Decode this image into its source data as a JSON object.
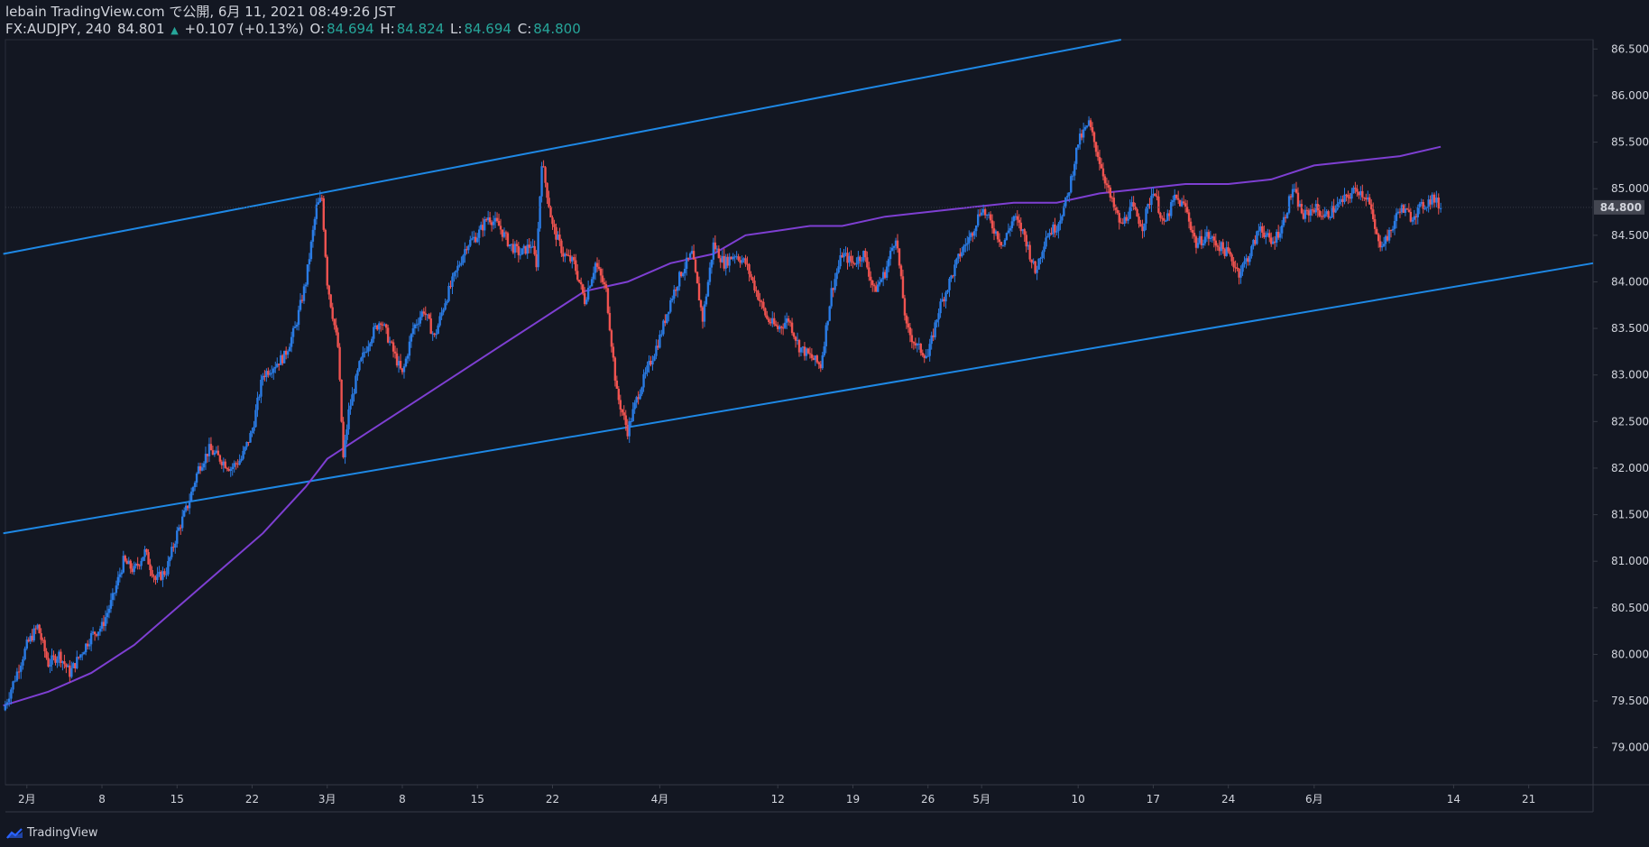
{
  "header": {
    "line1": "lebain TradingView.com で公開, 6月 11, 2021 08:49:26 JST",
    "symbol": "FX:AUDJPY, 240",
    "last": "84.801",
    "change": "+0.107 (+0.13%)",
    "o_label": "O:",
    "o_value": "84.694",
    "h_label": "H:",
    "h_value": "84.824",
    "l_label": "L:",
    "l_value": "84.694",
    "c_label": "C:",
    "c_value": "84.800"
  },
  "brand": {
    "name": "TradingView",
    "icon": "tradingview-logo-icon"
  },
  "colors": {
    "background": "#131722",
    "bullish": "#2a7be4",
    "bearish": "#ef5350",
    "moving_average": "#7e3fd2",
    "channel": "#1e88e5",
    "price_label_bg": "#434651"
  },
  "chart_data": {
    "type": "candlestick",
    "symbol": "FX:AUDJPY",
    "interval": "240",
    "ylim": [
      78.6,
      86.6
    ],
    "y_ticks": [
      "79.000",
      "79.500",
      "80.000",
      "80.500",
      "81.000",
      "81.500",
      "82.000",
      "82.500",
      "83.000",
      "83.500",
      "84.000",
      "84.500",
      "85.000",
      "85.500",
      "86.000",
      "86.500"
    ],
    "x_ticks": [
      {
        "label": "2月",
        "day": 0
      },
      {
        "label": "8",
        "day": 7
      },
      {
        "label": "15",
        "day": 14
      },
      {
        "label": "22",
        "day": 21
      },
      {
        "label": "3月",
        "day": 28
      },
      {
        "label": "8",
        "day": 35
      },
      {
        "label": "15",
        "day": 42
      },
      {
        "label": "22",
        "day": 49
      },
      {
        "label": "4月",
        "day": 59
      },
      {
        "label": "12",
        "day": 70
      },
      {
        "label": "19",
        "day": 77
      },
      {
        "label": "26",
        "day": 84
      },
      {
        "label": "5月",
        "day": 89
      },
      {
        "label": "10",
        "day": 98
      },
      {
        "label": "17",
        "day": 105
      },
      {
        "label": "24",
        "day": 112
      },
      {
        "label": "6月",
        "day": 120
      },
      {
        "label": "14",
        "day": 133
      },
      {
        "label": "21",
        "day": 140
      }
    ],
    "x_range_days": [
      -2,
      146
    ],
    "current_price": "84.800",
    "close_path": [
      [
        -2.2,
        79.4
      ],
      [
        0,
        80.1
      ],
      [
        1,
        80.3
      ],
      [
        2,
        79.9
      ],
      [
        3,
        80.0
      ],
      [
        4,
        79.8
      ],
      [
        5,
        80.0
      ],
      [
        6,
        80.2
      ],
      [
        7,
        80.3
      ],
      [
        8,
        80.6
      ],
      [
        9,
        81.0
      ],
      [
        10,
        80.9
      ],
      [
        11,
        81.1
      ],
      [
        12,
        80.8
      ],
      [
        13,
        80.9
      ],
      [
        14,
        81.3
      ],
      [
        15,
        81.6
      ],
      [
        16,
        82.0
      ],
      [
        17,
        82.2
      ],
      [
        18,
        82.1
      ],
      [
        19,
        82.0
      ],
      [
        20,
        82.1
      ],
      [
        21,
        82.4
      ],
      [
        22,
        83.0
      ],
      [
        23,
        83.1
      ],
      [
        24,
        83.2
      ],
      [
        25,
        83.5
      ],
      [
        26,
        84.0
      ],
      [
        27,
        84.8
      ],
      [
        27.5,
        84.9
      ],
      [
        28,
        84.0
      ],
      [
        29,
        83.3
      ],
      [
        29.5,
        82.1
      ],
      [
        30,
        82.6
      ],
      [
        31,
        83.1
      ],
      [
        32,
        83.4
      ],
      [
        33,
        83.6
      ],
      [
        34,
        83.3
      ],
      [
        35,
        83.0
      ],
      [
        36,
        83.5
      ],
      [
        37,
        83.7
      ],
      [
        38,
        83.4
      ],
      [
        39,
        83.8
      ],
      [
        40,
        84.1
      ],
      [
        41,
        84.4
      ],
      [
        42,
        84.5
      ],
      [
        43,
        84.7
      ],
      [
        44,
        84.6
      ],
      [
        45,
        84.4
      ],
      [
        46,
        84.3
      ],
      [
        47,
        84.4
      ],
      [
        47.5,
        84.2
      ],
      [
        48,
        85.3
      ],
      [
        49,
        84.6
      ],
      [
        50,
        84.3
      ],
      [
        51,
        84.2
      ],
      [
        52,
        83.8
      ],
      [
        53,
        84.2
      ],
      [
        54,
        83.9
      ],
      [
        55,
        82.8
      ],
      [
        56,
        82.4
      ],
      [
        57,
        82.8
      ],
      [
        58,
        83.1
      ],
      [
        59,
        83.4
      ],
      [
        60,
        83.8
      ],
      [
        61,
        84.1
      ],
      [
        62,
        84.3
      ],
      [
        63,
        83.6
      ],
      [
        64,
        84.4
      ],
      [
        65,
        84.2
      ],
      [
        66,
        84.3
      ],
      [
        67,
        84.2
      ],
      [
        68,
        83.9
      ],
      [
        69,
        83.6
      ],
      [
        70,
        83.5
      ],
      [
        71,
        83.6
      ],
      [
        72,
        83.3
      ],
      [
        73,
        83.2
      ],
      [
        74,
        83.1
      ],
      [
        75,
        83.9
      ],
      [
        76,
        84.3
      ],
      [
        77,
        84.2
      ],
      [
        78,
        84.3
      ],
      [
        79,
        83.9
      ],
      [
        80,
        84.1
      ],
      [
        81,
        84.5
      ],
      [
        82,
        83.5
      ],
      [
        83,
        83.3
      ],
      [
        84,
        83.2
      ],
      [
        85,
        83.7
      ],
      [
        86,
        84.0
      ],
      [
        87,
        84.3
      ],
      [
        88,
        84.5
      ],
      [
        89,
        84.8
      ],
      [
        90,
        84.6
      ],
      [
        91,
        84.4
      ],
      [
        92,
        84.7
      ],
      [
        93,
        84.5
      ],
      [
        94,
        84.1
      ],
      [
        95,
        84.5
      ],
      [
        96,
        84.6
      ],
      [
        97,
        84.9
      ],
      [
        98,
        85.5
      ],
      [
        99,
        85.7
      ],
      [
        100,
        85.3
      ],
      [
        101,
        84.9
      ],
      [
        102,
        84.6
      ],
      [
        103,
        84.8
      ],
      [
        104,
        84.6
      ],
      [
        105,
        85.0
      ],
      [
        106,
        84.6
      ],
      [
        107,
        84.9
      ],
      [
        108,
        84.8
      ],
      [
        109,
        84.4
      ],
      [
        110,
        84.5
      ],
      [
        111,
        84.4
      ],
      [
        112,
        84.3
      ],
      [
        113,
        84.1
      ],
      [
        114,
        84.3
      ],
      [
        115,
        84.6
      ],
      [
        116,
        84.4
      ],
      [
        117,
        84.6
      ],
      [
        118,
        85.0
      ],
      [
        119,
        84.7
      ],
      [
        120,
        84.8
      ],
      [
        121,
        84.7
      ],
      [
        122,
        84.8
      ],
      [
        123,
        84.9
      ],
      [
        124,
        85.0
      ],
      [
        125,
        84.9
      ],
      [
        126,
        84.4
      ],
      [
        127,
        84.5
      ],
      [
        128,
        84.8
      ],
      [
        129,
        84.7
      ],
      [
        130,
        84.8
      ],
      [
        131,
        84.9
      ],
      [
        131.8,
        84.8
      ]
    ],
    "moving_average": [
      [
        -2.2,
        79.45
      ],
      [
        2,
        79.6
      ],
      [
        6,
        79.8
      ],
      [
        10,
        80.1
      ],
      [
        14,
        80.5
      ],
      [
        18,
        80.9
      ],
      [
        22,
        81.3
      ],
      [
        26,
        81.8
      ],
      [
        28,
        82.1
      ],
      [
        32,
        82.4
      ],
      [
        36,
        82.7
      ],
      [
        40,
        83.0
      ],
      [
        44,
        83.3
      ],
      [
        48,
        83.6
      ],
      [
        52,
        83.9
      ],
      [
        56,
        84.0
      ],
      [
        60,
        84.2
      ],
      [
        64,
        84.3
      ],
      [
        67,
        84.5
      ],
      [
        70,
        84.55
      ],
      [
        73,
        84.6
      ],
      [
        76,
        84.6
      ],
      [
        80,
        84.7
      ],
      [
        84,
        84.75
      ],
      [
        88,
        84.8
      ],
      [
        92,
        84.85
      ],
      [
        96,
        84.85
      ],
      [
        100,
        84.95
      ],
      [
        104,
        85.0
      ],
      [
        108,
        85.05
      ],
      [
        112,
        85.05
      ],
      [
        116,
        85.1
      ],
      [
        120,
        85.25
      ],
      [
        124,
        85.3
      ],
      [
        128,
        85.35
      ],
      [
        131.8,
        85.45
      ]
    ],
    "channel_lines": [
      {
        "name": "upper",
        "from": {
          "day": -2.2,
          "price": 84.3
        },
        "to": {
          "day": 102,
          "price": 86.6
        }
      },
      {
        "name": "lower",
        "from": {
          "day": -2.2,
          "price": 81.3
        },
        "to": {
          "day": 146,
          "price": 84.2
        }
      }
    ]
  }
}
